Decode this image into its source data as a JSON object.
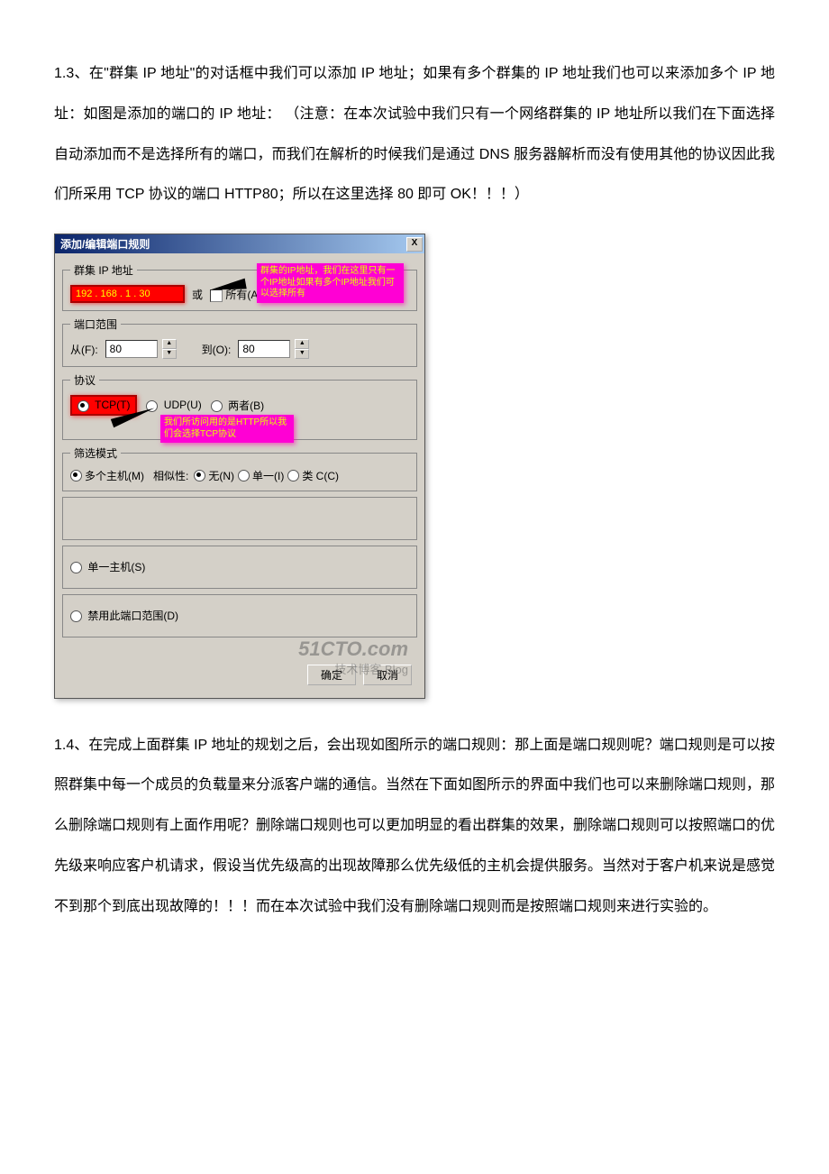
{
  "paragraphs": {
    "p1": "1.3、在\"群集 IP 地址\"的对话框中我们可以添加 IP 地址；如果有多个群集的 IP 地址我们也可以来添加多个 IP 地址：如图是添加的端口的 IP 地址： （注意：在本次试验中我们只有一个网络群集的 IP 地址所以我们在下面选择自动添加而不是选择所有的端口，而我们在解析的时候我们是通过 DNS 服务器解析而没有使用其他的协议因此我们所采用 TCP 协议的端口 HTTP80；所以在这里选择 80 即可 OK！！！）",
    "p2": "1.4、在完成上面群集 IP 地址的规划之后，会出现如图所示的端口规则：那上面是端口规则呢？端口规则是可以按照群集中每一个成员的负载量来分派客户端的通信。当然在下面如图所示的界面中我们也可以来删除端口规则，那么删除端口规则有上面作用呢？删除端口规则也可以更加明显的看出群集的效果，删除端口规则可以按照端口的优先级来响应客户机请求，假设当优先级高的出现故障那么优先级低的主机会提供服务。当然对于客户机来说是感觉不到那个到底出现故障的！！！而在本次试验中我们没有删除端口规则而是按照端口规则来进行实验的。"
  },
  "dialog": {
    "title": "添加/编辑端口规则",
    "close": "X",
    "group_ip": {
      "legend": "群集 IP 地址",
      "value": "192 . 168 .   1 .  30",
      "or": "或",
      "all_label": "所有(A)",
      "callout": "群集的IP地址，我们在这里只有一个IP地址如果有多个IP地址我们可以选择所有"
    },
    "port_range": {
      "legend": "端口范围",
      "from_label": "从(F):",
      "from_value": "80",
      "to_label": "到(O):",
      "to_value": "80"
    },
    "protocol": {
      "legend": "协议",
      "tcp_label": "TCP(T)",
      "udp_label": "UDP(U)",
      "both_label": "两者(B)",
      "callout": "我们所访问用的是HTTP所以我们会选择TCP协议"
    },
    "filter": {
      "legend": "筛选模式",
      "multi_label": "多个主机(M)",
      "similarity_label": "相似性:",
      "none_label": "无(N)",
      "single_label": "单一(I)",
      "classc_label": "类 C(C)"
    },
    "single_host": "单一主机(S)",
    "disable_range": "禁用此端口范围(D)",
    "watermark": "51CTO.com",
    "watermark_sub": "技术博客 Blog",
    "ok_btn": "确定",
    "cancel_btn": "取消"
  }
}
